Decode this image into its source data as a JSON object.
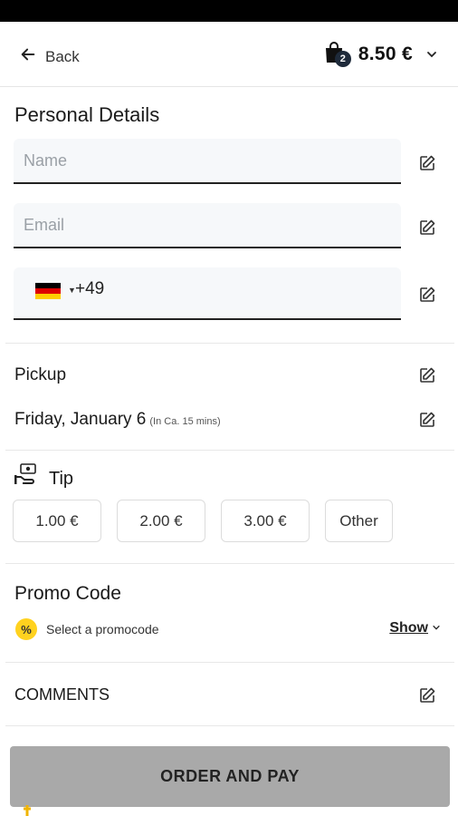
{
  "header": {
    "back_label": "Back",
    "cart_count": "2",
    "cart_total": "8.50 €"
  },
  "personal": {
    "title": "Personal Details",
    "name_placeholder": "Name",
    "email_placeholder": "Email",
    "phone_code": "+49"
  },
  "pickup": {
    "label": "Pickup",
    "date": "Friday, January 6",
    "eta": "(In Ca. 15 mins)"
  },
  "tip": {
    "title": "Tip",
    "options": [
      "1.00 €",
      "2.00 €",
      "3.00 €",
      "Other"
    ]
  },
  "promo": {
    "title": "Promo Code",
    "badge": "%",
    "select_text": "Select a promocode",
    "show_label": "Show"
  },
  "comments": {
    "label": "COMMENTS"
  },
  "order": {
    "button_label": "ORDER AND PAY"
  },
  "colors": {
    "accent_badge": "#ffd21f",
    "order_button": "#a9a9a9",
    "cart_badge": "#1e2a3a"
  }
}
